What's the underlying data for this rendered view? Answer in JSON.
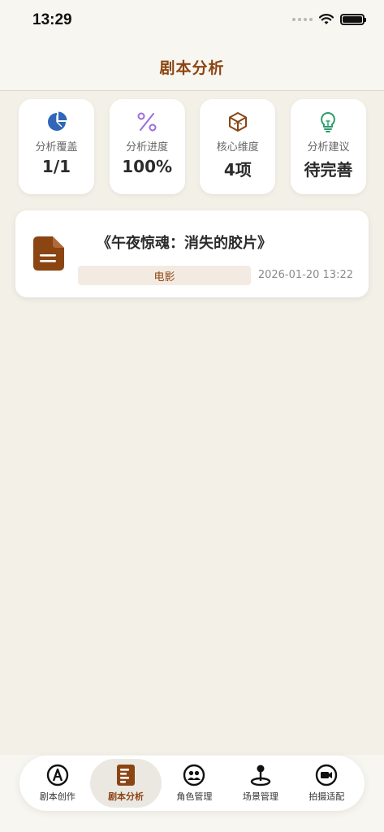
{
  "status_bar": {
    "time": "13:29"
  },
  "header": {
    "title": "剧本分析"
  },
  "stats": [
    {
      "icon": "pie-chart-icon",
      "label": "分析覆盖",
      "value": "1/1"
    },
    {
      "icon": "percent-icon",
      "label": "分析进度",
      "value": "100%"
    },
    {
      "icon": "cube-icon",
      "label": "核心维度",
      "value": "4项"
    },
    {
      "icon": "lightbulb-icon",
      "label": "分析建议",
      "value": "待完善"
    }
  ],
  "script": {
    "icon": "document-icon",
    "title": "《午夜惊魂：消失的胶片》",
    "tag": "电影",
    "updated": "2026-01-20 13:22"
  },
  "tabs": [
    {
      "icon": "pen-icon",
      "label": "剧本创作",
      "active": false
    },
    {
      "icon": "script-icon",
      "label": "剧本分析",
      "active": true
    },
    {
      "icon": "people-icon",
      "label": "角色管理",
      "active": false
    },
    {
      "icon": "location-pin-icon",
      "label": "场景管理",
      "active": false
    },
    {
      "icon": "video-camera-icon",
      "label": "拍摄适配",
      "active": false
    }
  ],
  "colors": {
    "brand": "#8b4513",
    "background": "#f3f0e8",
    "pie_icon": "#3067b8",
    "percent_icon": "#9b6be0",
    "cube_icon": "#8b4513",
    "bulb_icon": "#2e9c6a"
  }
}
